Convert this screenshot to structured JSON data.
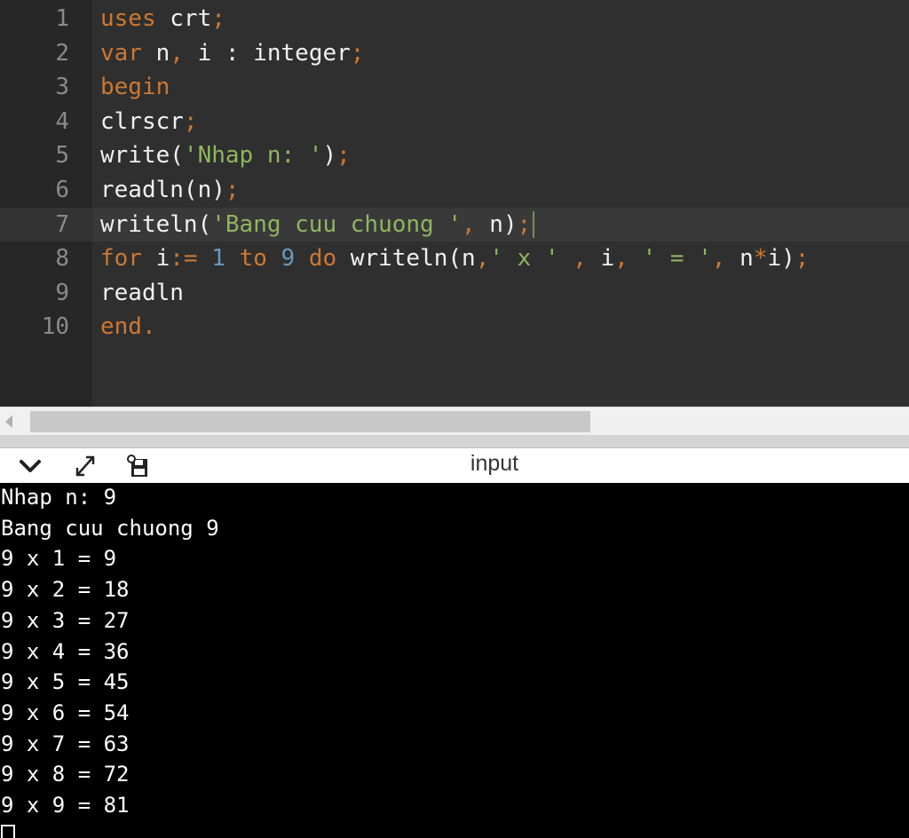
{
  "editor": {
    "active_line": 7,
    "lines": [
      {
        "n": "1",
        "tokens": [
          [
            "kw",
            "uses"
          ],
          [
            "txt",
            " crt"
          ],
          [
            "pun",
            ";"
          ]
        ]
      },
      {
        "n": "2",
        "tokens": [
          [
            "kw",
            "var"
          ],
          [
            "txt",
            " n"
          ],
          [
            "pun",
            ","
          ],
          [
            "txt",
            " i : integer"
          ],
          [
            "pun",
            ";"
          ]
        ]
      },
      {
        "n": "3",
        "tokens": [
          [
            "kw",
            "begin"
          ]
        ]
      },
      {
        "n": "4",
        "tokens": [
          [
            "txt",
            "clrscr"
          ],
          [
            "pun",
            ";"
          ]
        ]
      },
      {
        "n": "5",
        "tokens": [
          [
            "txt",
            "write("
          ],
          [
            "str",
            "'Nhap n: '"
          ],
          [
            "txt",
            ")"
          ],
          [
            "pun",
            ";"
          ]
        ]
      },
      {
        "n": "6",
        "tokens": [
          [
            "txt",
            "readln(n)"
          ],
          [
            "pun",
            ";"
          ]
        ]
      },
      {
        "n": "7",
        "tokens": [
          [
            "txt",
            "writeln("
          ],
          [
            "str",
            "'Bang cuu chuong '"
          ],
          [
            "pun",
            ","
          ],
          [
            "txt",
            " n)"
          ],
          [
            "pun",
            ";"
          ]
        ]
      },
      {
        "n": "8",
        "tokens": [
          [
            "kw",
            "for"
          ],
          [
            "txt",
            " i"
          ],
          [
            "pun",
            ":="
          ],
          [
            "txt",
            " "
          ],
          [
            "num",
            "1"
          ],
          [
            "txt",
            " "
          ],
          [
            "kw",
            "to"
          ],
          [
            "txt",
            " "
          ],
          [
            "num",
            "9"
          ],
          [
            "txt",
            " "
          ],
          [
            "kw",
            "do"
          ],
          [
            "txt",
            " writeln(n"
          ],
          [
            "pun",
            ","
          ],
          [
            "str",
            "' x '"
          ],
          [
            "txt",
            " "
          ],
          [
            "pun",
            ","
          ],
          [
            "txt",
            " i"
          ],
          [
            "pun",
            ","
          ],
          [
            "txt",
            " "
          ],
          [
            "str",
            "' = '"
          ],
          [
            "pun",
            ","
          ],
          [
            "txt",
            " n"
          ],
          [
            "pun",
            "*"
          ],
          [
            "txt",
            "i)"
          ],
          [
            "pun",
            ";"
          ]
        ]
      },
      {
        "n": "9",
        "tokens": [
          [
            "txt",
            "readln"
          ]
        ]
      },
      {
        "n": "10",
        "tokens": [
          [
            "kw",
            "end"
          ],
          [
            "pun",
            "."
          ]
        ]
      }
    ]
  },
  "console_header": {
    "title": "input",
    "icons": [
      "chevron-down-icon",
      "expand-icon",
      "save-icon"
    ]
  },
  "console": {
    "lines": [
      "Nhap n: 9",
      "Bang cuu chuong 9",
      "9 x 1 = 9",
      "9 x 2 = 18",
      "9 x 3 = 27",
      "9 x 4 = 36",
      "9 x 5 = 45",
      "9 x 6 = 54",
      "9 x 7 = 63",
      "9 x 8 = 72",
      "9 x 9 = 81"
    ]
  },
  "colors": {
    "keyword": "#cc7832",
    "string": "#8fb55e",
    "number": "#6897bb",
    "text": "#f0f0f0",
    "editor_bg": "#2f2f2f",
    "console_bg": "#000000"
  }
}
